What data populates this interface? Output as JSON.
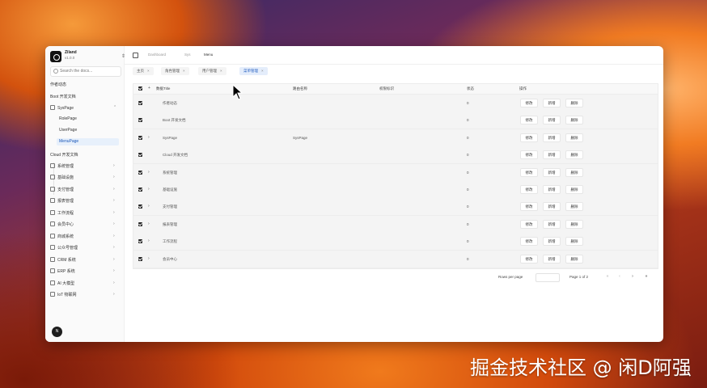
{
  "workspace": {
    "name": "Ziland",
    "version": "v1.0.0"
  },
  "search": {
    "placeholder": "Search the docs..."
  },
  "sidebar": {
    "items": [
      {
        "label": "作者动态"
      },
      {
        "label": "Boot 开发文档"
      },
      {
        "label": "SysPage"
      },
      {
        "label": "RolePage"
      },
      {
        "label": "UserPage"
      },
      {
        "label": "MenuPage"
      },
      {
        "label": "Cloud 开发文档"
      },
      {
        "label": "系统管理"
      },
      {
        "label": "基础设施"
      },
      {
        "label": "支付管理"
      },
      {
        "label": "报表管理"
      },
      {
        "label": "工作流程"
      },
      {
        "label": "会员中心"
      },
      {
        "label": "商城系统"
      },
      {
        "label": "公众号管理"
      },
      {
        "label": "CRM 系统"
      },
      {
        "label": "ERP 系统"
      },
      {
        "label": "AI 大模型"
      },
      {
        "label": "IoT 物联网"
      }
    ]
  },
  "avatar": {
    "initial": "N"
  },
  "breadcrumb": [
    "Dashboard",
    "Sys",
    "Menu"
  ],
  "tabs": [
    {
      "label": "主页"
    },
    {
      "label": "角色管理"
    },
    {
      "label": "用户管理"
    },
    {
      "label": "菜单管理"
    }
  ],
  "table": {
    "headers": [
      "数据Title",
      "路由名称",
      "权限标识",
      "状态",
      "操作"
    ],
    "rows": [
      {
        "title": "作者动态",
        "route": "",
        "status": "0",
        "expandable": false
      },
      {
        "title": "Boot 开发文档",
        "route": "",
        "status": "0",
        "expandable": false
      },
      {
        "title": "SysPage",
        "route": "SysPage",
        "status": "0",
        "expandable": true
      },
      {
        "title": "Cloud 开发文档",
        "route": "",
        "status": "0",
        "expandable": false
      },
      {
        "title": "系统管理",
        "route": "",
        "status": "0",
        "expandable": true
      },
      {
        "title": "基础设施",
        "route": "",
        "status": "0",
        "expandable": true
      },
      {
        "title": "支付管理",
        "route": "",
        "status": "0",
        "expandable": true
      },
      {
        "title": "报表管理",
        "route": "",
        "status": "0",
        "expandable": true
      },
      {
        "title": "工作流程",
        "route": "",
        "status": "0",
        "expandable": true
      },
      {
        "title": "会员中心",
        "route": "",
        "status": "0",
        "expandable": true
      }
    ],
    "actions": [
      "修改",
      "新增",
      "删除"
    ]
  },
  "pagination": {
    "rows_per_page_label": "Rows per page",
    "page_label": "Page 1 of 2"
  },
  "watermark": "掘金技术社区 @ 闲D阿强"
}
